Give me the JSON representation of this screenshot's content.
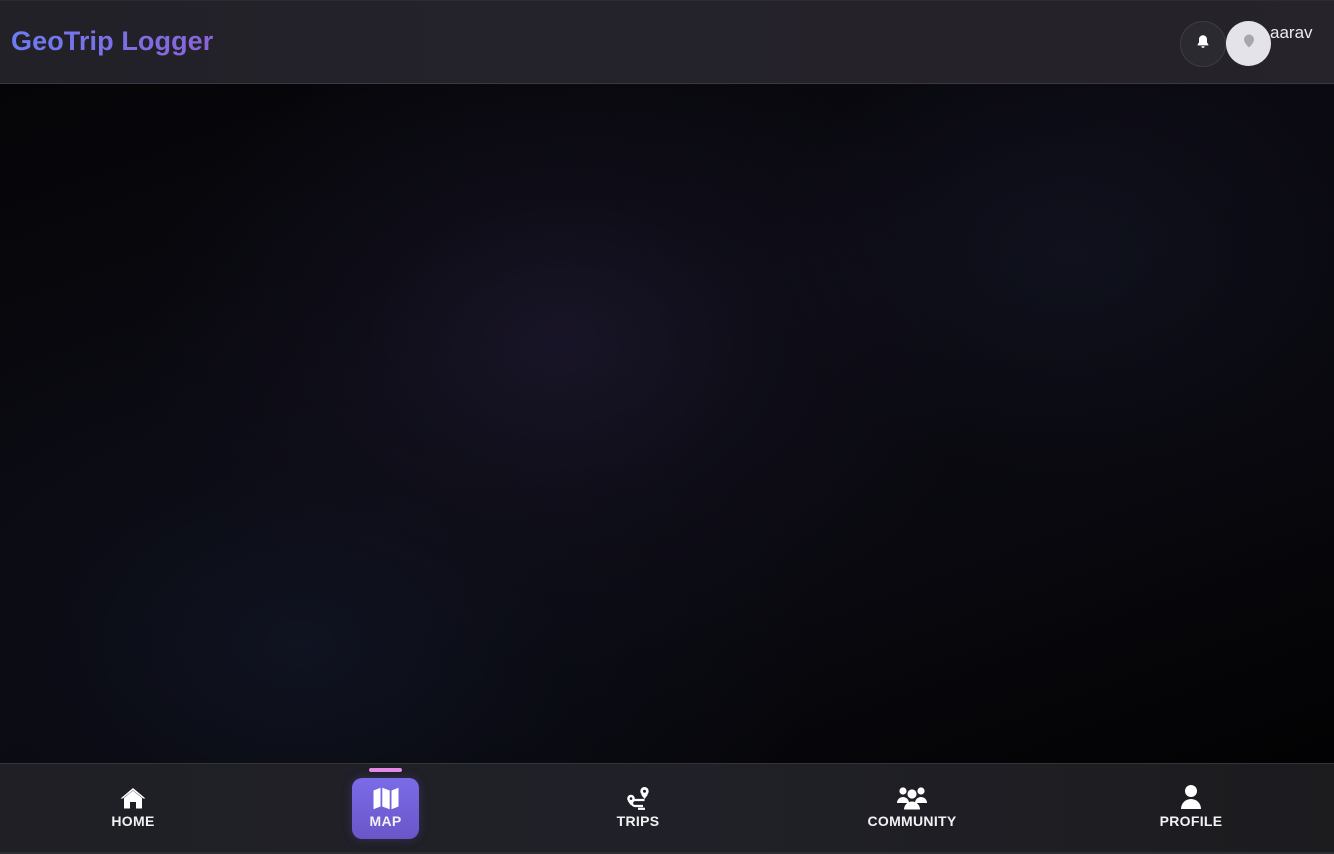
{
  "header": {
    "app_title": "GeoTrip Logger",
    "username": "aarav",
    "notification_icon": "bell-icon",
    "avatar_icon": "map-pin-icon"
  },
  "colors": {
    "brand_gradient_start": "#6d7cf2",
    "brand_gradient_end": "#8a64d8",
    "active_tab_bg": "#7b6be8",
    "active_indicator": "#e58be6"
  },
  "nav": {
    "active": "MAP",
    "items": [
      {
        "label": "HOME",
        "icon": "home-icon"
      },
      {
        "label": "MAP",
        "icon": "map-icon"
      },
      {
        "label": "TRIPS",
        "icon": "route-icon"
      },
      {
        "label": "COMMUNITY",
        "icon": "users-icon"
      },
      {
        "label": "PROFILE",
        "icon": "user-icon"
      }
    ]
  }
}
